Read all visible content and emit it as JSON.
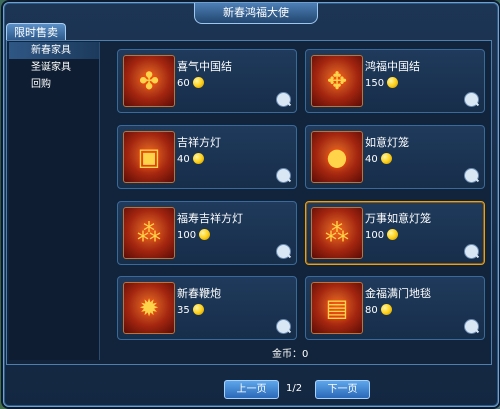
{
  "window": {
    "title": "新春鸿福大使"
  },
  "tab": {
    "label": "限时售卖"
  },
  "categories": [
    {
      "label": "新春家具"
    },
    {
      "label": "圣诞家具"
    },
    {
      "label": "回购"
    }
  ],
  "items": [
    {
      "name": "喜气中国结",
      "price": "60",
      "icon": "chinese-knot-icon"
    },
    {
      "name": "鸿福中国结",
      "price": "150",
      "icon": "lantern-knot-icon"
    },
    {
      "name": "吉祥方灯",
      "price": "40",
      "icon": "square-lantern-icon"
    },
    {
      "name": "如意灯笼",
      "price": "40",
      "icon": "round-lantern-icon"
    },
    {
      "name": "福寿吉祥方灯",
      "price": "100",
      "icon": "lantern-string-icon"
    },
    {
      "name": "万事如意灯笼",
      "price": "100",
      "icon": "lantern-string-icon"
    },
    {
      "name": "新春鞭炮",
      "price": "35",
      "icon": "firecracker-icon"
    },
    {
      "name": "金福满门地毯",
      "price": "80",
      "icon": "carpet-icon"
    }
  ],
  "gold": {
    "label": "金币：",
    "value": "0"
  },
  "pagination": {
    "prev_label": "上一页",
    "next_label": "下一页",
    "page_text": "1/2"
  },
  "colors": {
    "selected_border": "#e6a21c",
    "panel_bg": "#1d3554",
    "accent_border": "#6fa0d0"
  }
}
